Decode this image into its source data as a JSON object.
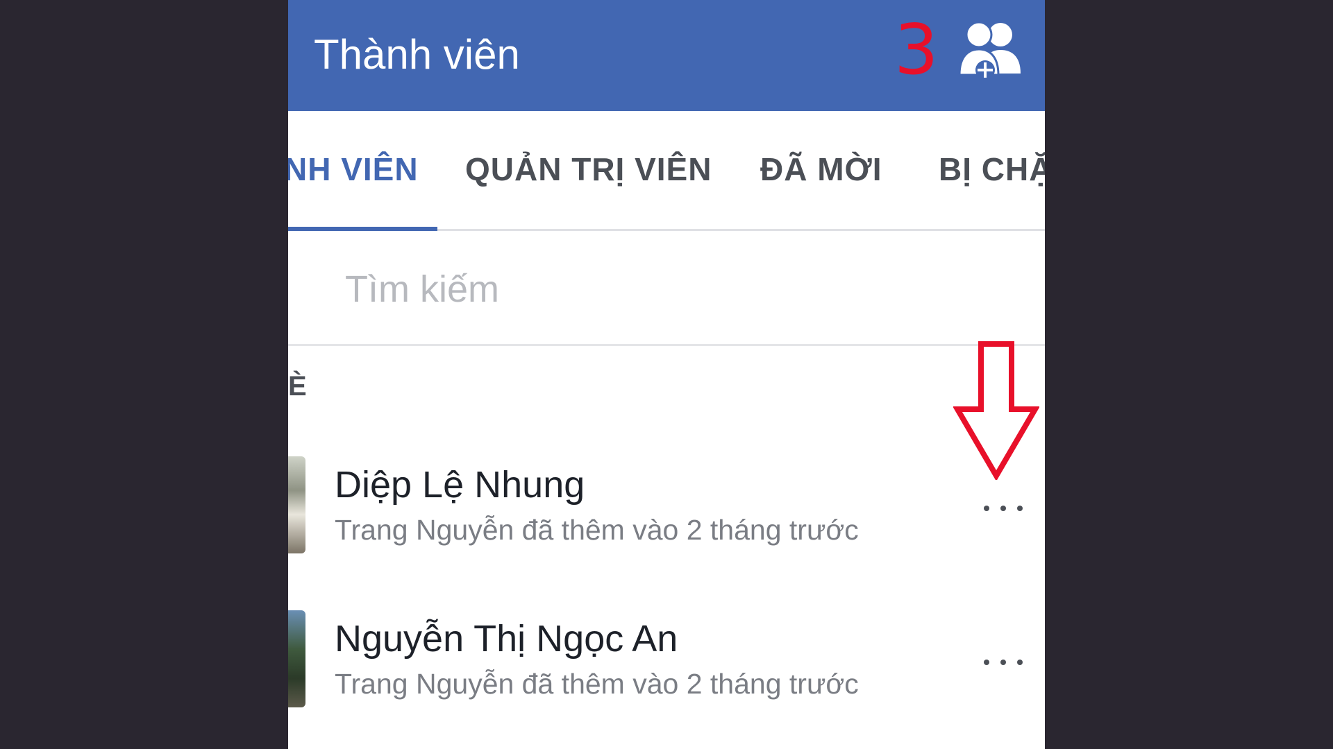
{
  "header": {
    "title": "Thành viên",
    "step_number": "3",
    "add_member_icon": "add-members-icon"
  },
  "tabs": [
    {
      "label": "NH VIÊN",
      "active": true
    },
    {
      "label": "QUẢN TRỊ VIÊN",
      "active": false
    },
    {
      "label": "ĐÃ MỜI",
      "active": false
    },
    {
      "label": "BỊ CHẶ",
      "active": false
    }
  ],
  "search": {
    "placeholder": "Tìm kiếm",
    "value": ""
  },
  "section": {
    "label": "È"
  },
  "members": [
    {
      "name": "Diệp Lệ Nhung",
      "meta": "Trang Nguyễn đã thêm vào 2 tháng trước"
    },
    {
      "name": "Nguyễn Thị Ngọc An",
      "meta": "Trang Nguyễn đã thêm vào 2 tháng trước"
    }
  ],
  "colors": {
    "header_bg": "#4267b2",
    "accent": "#4267b2",
    "annotation": "#e8102a",
    "backdrop": "#2a2630"
  },
  "annotation": {
    "icon": "down-arrow-icon"
  }
}
